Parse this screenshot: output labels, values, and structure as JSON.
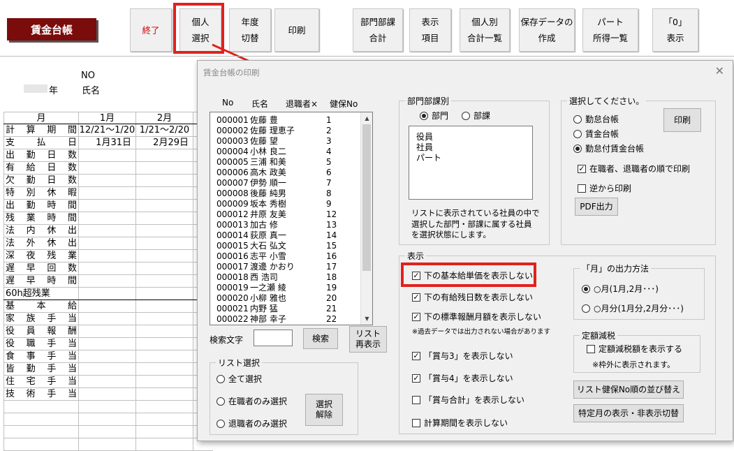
{
  "app_title": "賃金台帳",
  "toolbar": [
    {
      "id": "end",
      "lines": [
        "終了"
      ]
    },
    {
      "id": "individual",
      "lines": [
        "個人",
        "選択"
      ]
    },
    {
      "id": "year",
      "lines": [
        "年度",
        "切替"
      ]
    },
    {
      "id": "print",
      "lines": [
        "印刷"
      ]
    },
    {
      "id": "dept_total",
      "lines": [
        "部門部課",
        "合計"
      ]
    },
    {
      "id": "display",
      "lines": [
        "表示",
        "項目"
      ]
    },
    {
      "id": "person_total",
      "lines": [
        "個人別",
        "合計一覧"
      ]
    },
    {
      "id": "save_data",
      "lines": [
        "保存データの",
        "作成"
      ]
    },
    {
      "id": "part",
      "lines": [
        "パート",
        "所得一覧"
      ]
    },
    {
      "id": "zero",
      "lines": [
        "「0」",
        "表示"
      ]
    }
  ],
  "sheet": {
    "no_label": "NO",
    "year_label": "年",
    "name_label": "氏名",
    "month_header": "月",
    "month_cols": [
      "1月",
      "2月"
    ],
    "rows": [
      {
        "label": "計算期間",
        "v1": "12/21～1/20",
        "v2": "1/21～2/20"
      },
      {
        "label": "支払日",
        "v1": "1月31日",
        "v2": "2月29日"
      },
      {
        "label": "出勤日数",
        "v1": "",
        "v2": ""
      },
      {
        "label": "有給日数",
        "v1": "",
        "v2": ""
      },
      {
        "label": "欠勤日数",
        "v1": "",
        "v2": ""
      },
      {
        "label": "特別休暇",
        "v1": "",
        "v2": ""
      },
      {
        "label": "出勤時間",
        "v1": "",
        "v2": ""
      },
      {
        "label": "残業時間",
        "v1": "",
        "v2": ""
      },
      {
        "label": "法内休出",
        "v1": "",
        "v2": ""
      },
      {
        "label": "法外休出",
        "v1": "",
        "v2": ""
      },
      {
        "label": "深夜残業",
        "v1": "",
        "v2": ""
      },
      {
        "label": "遅早回数",
        "v1": "",
        "v2": ""
      },
      {
        "label": "遅早時間",
        "v1": "",
        "v2": ""
      },
      {
        "label": "60h超残業",
        "v1": "",
        "v2": ""
      },
      {
        "label": "基本給",
        "v1": "",
        "v2": ""
      },
      {
        "label": "家族手当",
        "v1": "",
        "v2": ""
      },
      {
        "label": "役員報酬",
        "v1": "",
        "v2": ""
      },
      {
        "label": "役職手当",
        "v1": "",
        "v2": ""
      },
      {
        "label": "食事手当",
        "v1": "",
        "v2": ""
      },
      {
        "label": "皆勤手当",
        "v1": "",
        "v2": ""
      },
      {
        "label": "住宅手当",
        "v1": "",
        "v2": ""
      },
      {
        "label": "技術手当",
        "v1": "",
        "v2": ""
      }
    ]
  },
  "dialog": {
    "title": "賃金台帳の印刷",
    "list_headers": {
      "no": "No",
      "name": "氏名",
      "retired": "退職者×",
      "health_no": "健保No"
    },
    "employees": [
      {
        "no": "000001",
        "name": "佐藤 豊",
        "hno": "1"
      },
      {
        "no": "000002",
        "name": "佐藤 理恵子",
        "hno": "2"
      },
      {
        "no": "000003",
        "name": "佐藤 望",
        "hno": "3"
      },
      {
        "no": "000004",
        "name": "小林 良二",
        "hno": "4"
      },
      {
        "no": "000005",
        "name": "三浦 和美",
        "hno": "5"
      },
      {
        "no": "000006",
        "name": "高木 政美",
        "hno": "6"
      },
      {
        "no": "000007",
        "name": "伊勢 順一",
        "hno": "7"
      },
      {
        "no": "000008",
        "name": "後藤 純男",
        "hno": "8"
      },
      {
        "no": "000009",
        "name": "坂本 秀樹",
        "hno": "9"
      },
      {
        "no": "000012",
        "name": "井原 友美",
        "hno": "12"
      },
      {
        "no": "000013",
        "name": "加古 修",
        "hno": "13"
      },
      {
        "no": "000014",
        "name": "荻原 真一",
        "hno": "14"
      },
      {
        "no": "000015",
        "name": "大石 弘文",
        "hno": "15"
      },
      {
        "no": "000016",
        "name": "志平 小雪",
        "hno": "16"
      },
      {
        "no": "000017",
        "name": "渡邊 かおり",
        "hno": "17"
      },
      {
        "no": "000018",
        "name": "西 浩司",
        "hno": "18"
      },
      {
        "no": "000019",
        "name": "一之瀬 綾",
        "hno": "19"
      },
      {
        "no": "000020",
        "name": "小柳 雅也",
        "hno": "20"
      },
      {
        "no": "000021",
        "name": "内野 猛",
        "hno": "21"
      },
      {
        "no": "000022",
        "name": "神部 幸子",
        "hno": "22"
      }
    ],
    "search_label": "検索文字",
    "search_value": "",
    "search_button": "検索",
    "list_redisplay": [
      "リスト",
      "再表示"
    ],
    "list_select": {
      "label": "リスト選択",
      "options": [
        "全て選択",
        "在職者のみ選択",
        "退職者のみ選択"
      ],
      "deselect": [
        "選択",
        "解除"
      ]
    },
    "dept": {
      "label": "部門部課別",
      "options": [
        "部門",
        "部課"
      ],
      "selected": "部門",
      "items": [
        "役員",
        "社員",
        "パート"
      ],
      "note": [
        "リストに表示されている社員の中で",
        "選択した部門・部課に属する社員",
        "を選択状態にします。"
      ]
    },
    "select": {
      "label": "選択してください。",
      "options": [
        "勤怠台帳",
        "賃金台帳",
        "勤怠付賃金台帳"
      ],
      "selected": "勤怠付賃金台帳",
      "print_button": "印刷",
      "order_check": "在職者、退職者の順で印刷",
      "reverse_check": "逆から印刷",
      "pdf_button": "PDF出力"
    },
    "display": {
      "label": "表示",
      "checks": [
        {
          "text": "下の基本給単価を表示しない",
          "checked": true
        },
        {
          "text": "下の有給残日数を表示しない",
          "checked": true
        },
        {
          "text": "下の標準報酬月額を表示しない",
          "checked": true
        }
      ],
      "small_note": "※過去データでは出力されない場合があります",
      "checks2": [
        {
          "text": "「賞与3」を表示しない",
          "checked": true
        },
        {
          "text": "「賞与4」を表示しない",
          "checked": true
        },
        {
          "text": "「賞与合計」を表示しない",
          "checked": false
        },
        {
          "text": "計算期間を表示しない",
          "checked": false
        }
      ]
    },
    "month_output": {
      "label": "「月」の出力方法",
      "options": [
        "○月(1月,2月･･･)",
        "○月分(1月分,2月分･･･)"
      ],
      "selected": 0
    },
    "fixed_tax": {
      "label": "定額減税",
      "check": "定額減税額を表示する",
      "note": "※枠外に表示されます。"
    },
    "sort_button": "リスト健保No順の並び替え",
    "month_toggle_button": "特定月の表示・非表示切替"
  },
  "colors": {
    "title_bg": "#7b0c0c",
    "highlight": "#e2211c",
    "end_text": "#d00000"
  }
}
